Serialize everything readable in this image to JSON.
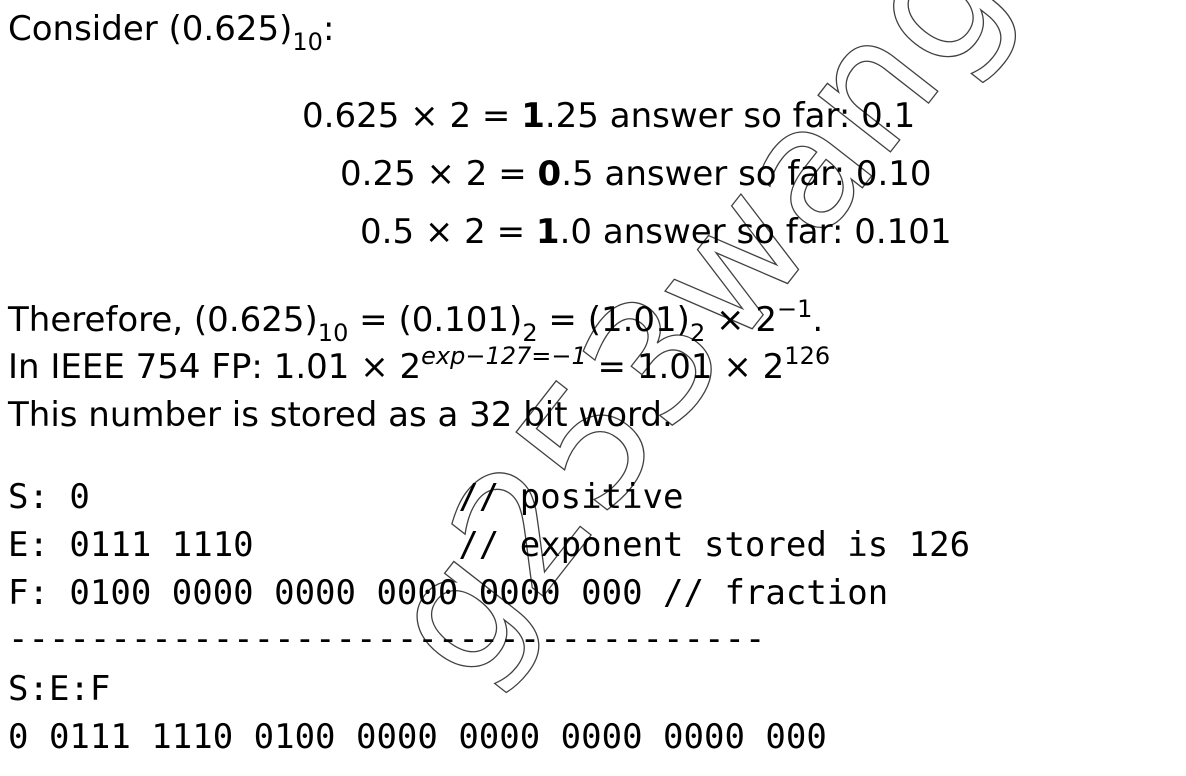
{
  "intro": {
    "prefix": "Consider (0.625)",
    "sub": "10",
    "suffix": ":"
  },
  "steps": [
    {
      "lhs": "0.625 × 2 = ",
      "bold": "1",
      "rest": ".25",
      "note": " answer so far: 0.1"
    },
    {
      "lhs": "0.25 × 2 = ",
      "bold": "0",
      "rest": ".5",
      "note": " answer so far: 0.10"
    },
    {
      "lhs": "0.5 × 2 = ",
      "bold": "1",
      "rest": ".0",
      "note": " answer so far: 0.101"
    }
  ],
  "therefore": {
    "p1": "Therefore, (0.625)",
    "s1": "10",
    "p2": " = (0.101)",
    "s2": "2",
    "p3": " = (1.01)",
    "s3": "2",
    "p4": " × 2",
    "sup": "−1",
    "p5": "."
  },
  "ieee": {
    "p1": "In IEEE 754 FP: 1.01 × 2",
    "sup1": "exp−127=−1",
    "p2": " = 1.01 × 2",
    "sup2": "126"
  },
  "stored": "This number is stored as a 32 bit word.",
  "fields": {
    "s": "S: 0                  // positive",
    "e": "E: 0111 1110          // exponent stored is 126",
    "f": "F: 0100 0000 0000 0000 0000 000 // fraction"
  },
  "divider": "-------------------------------------",
  "sef_label": "S:E:F",
  "sef_value": "0 0111 1110 0100 0000 0000 0000 0000 000",
  "watermark": "g253wang"
}
